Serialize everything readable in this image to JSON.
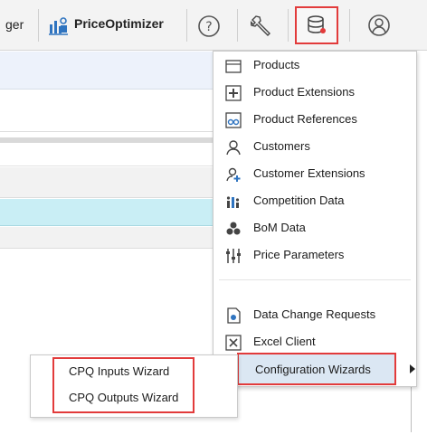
{
  "toolbar": {
    "left_label": "ger",
    "price_optimizer_label": "PriceOptimizer",
    "icons": [
      "price-optimizer-icon",
      "help-icon",
      "wrench-icon",
      "database-icon",
      "user-icon"
    ]
  },
  "menu": {
    "items": [
      {
        "label": "Products",
        "icon": "products-icon"
      },
      {
        "label": "Product Extensions",
        "icon": "product-extensions-icon"
      },
      {
        "label": "Product References",
        "icon": "product-references-icon"
      },
      {
        "label": "Customers",
        "icon": "customers-icon"
      },
      {
        "label": "Customer Extensions",
        "icon": "customer-extensions-icon"
      },
      {
        "label": "Competition Data",
        "icon": "competition-data-icon"
      },
      {
        "label": "BoM Data",
        "icon": "bom-data-icon"
      },
      {
        "label": "Price Parameters",
        "icon": "price-parameters-icon"
      },
      {
        "label": "Data Change Requests",
        "icon": "data-change-requests-icon"
      },
      {
        "label": "Excel Client",
        "icon": "excel-client-icon"
      }
    ],
    "configuration_wizards": "Configuration Wizards"
  },
  "submenu": {
    "items": [
      "CPQ Inputs Wizard",
      "CPQ Outputs Wizard"
    ]
  },
  "colors": {
    "highlight": "#e23b3b",
    "selected_row": "#c9eef5",
    "hover_item": "#dbe7f3"
  }
}
